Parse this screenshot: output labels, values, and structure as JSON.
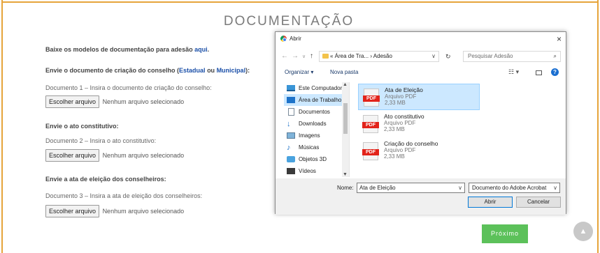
{
  "page": {
    "title": "DOCUMENTAÇÃO",
    "next_button": "Próximo",
    "scroll_top_icon": "chevron-up-icon"
  },
  "form": {
    "download_text": "Baixe os modelos de documentação para adesão",
    "download_link": "aqui",
    "download_end": ".",
    "section1_prefix": "Envie o documento de criação do conselho (",
    "section1_link1": "Estadual",
    "section1_mid": " ou ",
    "section1_link2": "Municipal",
    "section1_suffix": "):",
    "doc1_label": "Documento 1 – Insira o documento de criação do conselho:",
    "section2": "Envie o ato constitutivo:",
    "doc2_label": "Documento 2 – Insira o ato constitutivo:",
    "section3": "Envie a ata de eleição dos conselheiros:",
    "doc3_label": "Documento 3 – Insira a ata de eleição dos conselheiros:",
    "choose_file": "Escolher arquivo",
    "no_file": "Nenhum arquivo selecionado"
  },
  "dialog": {
    "title": "Abrir",
    "close": "×",
    "address": "« Área de Tra... › Adesão",
    "search_placeholder": "Pesquisar Adesão",
    "organize": "Organizar ▾",
    "new_folder": "Nova pasta",
    "help": "?",
    "nav_items": [
      {
        "label": "Este Computador",
        "icon": "computer-icon"
      },
      {
        "label": "Área de Trabalho",
        "icon": "desktop-icon"
      },
      {
        "label": "Documentos",
        "icon": "documents-icon"
      },
      {
        "label": "Downloads",
        "icon": "downloads-icon"
      },
      {
        "label": "Imagens",
        "icon": "images-icon"
      },
      {
        "label": "Músicas",
        "icon": "music-icon"
      },
      {
        "label": "Objetos 3D",
        "icon": "objects3d-icon"
      },
      {
        "label": "Vídeos",
        "icon": "videos-icon"
      }
    ],
    "selected_nav": "Área de Trabalho",
    "files": [
      {
        "name": "Ata de Eleição",
        "type": "Arquivo PDF",
        "size": "2,33 MB",
        "selected": true
      },
      {
        "name": "Ato constitutivo",
        "type": "Arquivo PDF",
        "size": "2,33 MB",
        "selected": false
      },
      {
        "name": "Criação do conselho",
        "type": "Arquivo PDF",
        "size": "2,33 MB",
        "selected": false
      }
    ],
    "pdf_label": "PDF",
    "name_label": "Nome:",
    "name_value": "Ata de Eleição",
    "filetype_value": "Documento do Adobe Acrobat",
    "open_button": "Abrir",
    "cancel_button": "Cancelar"
  },
  "colors": {
    "border": "#e6a43a",
    "link": "#1a4fa8",
    "next_button": "#5cc15a",
    "selection": "#cce8ff"
  }
}
